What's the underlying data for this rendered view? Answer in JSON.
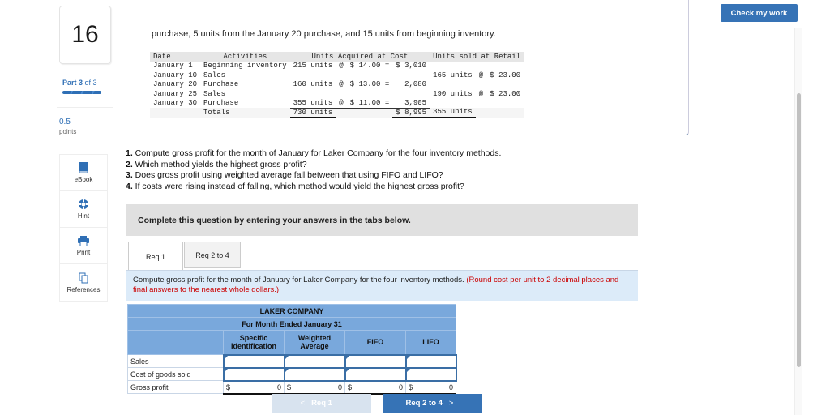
{
  "question": {
    "number": "16",
    "part_label_bold": "Part 3",
    "part_label_rest": " of 3",
    "part_progress": 1.0,
    "points_value": "0.5",
    "points_label": "points"
  },
  "tools": [
    {
      "label": "eBook",
      "icon": "book-icon"
    },
    {
      "label": "Hint",
      "icon": "lifebuoy-icon"
    },
    {
      "label": "Print",
      "icon": "printer-icon"
    },
    {
      "label": "References",
      "icon": "documents-icon"
    }
  ],
  "check_button": "Check my work",
  "intro_text": "purchase, 5 units from the January 20 purchase, and 15 units from beginning inventory.",
  "inventory": {
    "headers": {
      "date": "Date",
      "activities": "Activities",
      "acquired": "Units Acquired at Cost",
      "sold": "Units sold at Retail"
    },
    "rows": [
      {
        "date": "January 1",
        "activity": "Beginning inventory",
        "acq_units": "215 units",
        "acq_at": "@",
        "acq_cost": "$ 14.00 =",
        "acq_total": "$ 3,010",
        "sold_units": "",
        "sold_at": "",
        "sold_price": ""
      },
      {
        "date": "January 10",
        "activity": "Sales",
        "acq_units": "",
        "acq_at": "",
        "acq_cost": "",
        "acq_total": "",
        "sold_units": "165 units",
        "sold_at": "@",
        "sold_price": "$ 23.00"
      },
      {
        "date": "January 20",
        "activity": "Purchase",
        "acq_units": "160 units",
        "acq_at": "@",
        "acq_cost": "$ 13.00 =",
        "acq_total": "2,080",
        "sold_units": "",
        "sold_at": "",
        "sold_price": ""
      },
      {
        "date": "January 25",
        "activity": "Sales",
        "acq_units": "",
        "acq_at": "",
        "acq_cost": "",
        "acq_total": "",
        "sold_units": "190 units",
        "sold_at": "@",
        "sold_price": "$ 23.00"
      },
      {
        "date": "January 30",
        "activity": "Purchase",
        "acq_units": "355 units",
        "acq_at": "@",
        "acq_cost": "$ 11.00 =",
        "acq_total": "3,905",
        "sold_units": "",
        "sold_at": "",
        "sold_price": ""
      }
    ],
    "totals": {
      "label": "Totals",
      "acq_units": "730 units",
      "acq_total": "$ 8,995",
      "sold_units": "355 units"
    }
  },
  "questions": [
    {
      "num": "1.",
      "text": " Compute gross profit for the month of January for Laker Company for the four inventory methods."
    },
    {
      "num": "2.",
      "text": " Which method yields the highest gross profit?"
    },
    {
      "num": "3.",
      "text": " Does gross profit using weighted average fall between that using FIFO and LIFO?"
    },
    {
      "num": "4.",
      "text": " If costs were rising instead of falling, which method would yield the highest gross profit?"
    }
  ],
  "instructions": "Complete this question by entering your answers in the tabs below.",
  "tabs": [
    {
      "label": "Req 1",
      "active": true
    },
    {
      "label": "Req 2 to 4",
      "active": false
    }
  ],
  "panel": {
    "text": "Compute gross profit for the month of January for Laker Company for the four inventory methods. ",
    "note": "(Round cost per unit to 2 decimal places and final answers to the nearest whole dollars.)"
  },
  "laker_table": {
    "company": "LAKER COMPANY",
    "period": "For Month Ended January 31",
    "columns": [
      "Specific Identification",
      "Weighted Average",
      "FIFO",
      "LIFO"
    ],
    "rows": [
      {
        "label": "Sales",
        "values": [
          "",
          "",
          "",
          ""
        ]
      },
      {
        "label": "Cost of goods sold",
        "values": [
          "",
          "",
          "",
          ""
        ]
      },
      {
        "label": "Gross profit",
        "currency": "$",
        "values": [
          "0",
          "0",
          "0",
          "0"
        ]
      }
    ]
  },
  "nav": {
    "prev": "Req 1",
    "next": "Req 2 to 4"
  }
}
